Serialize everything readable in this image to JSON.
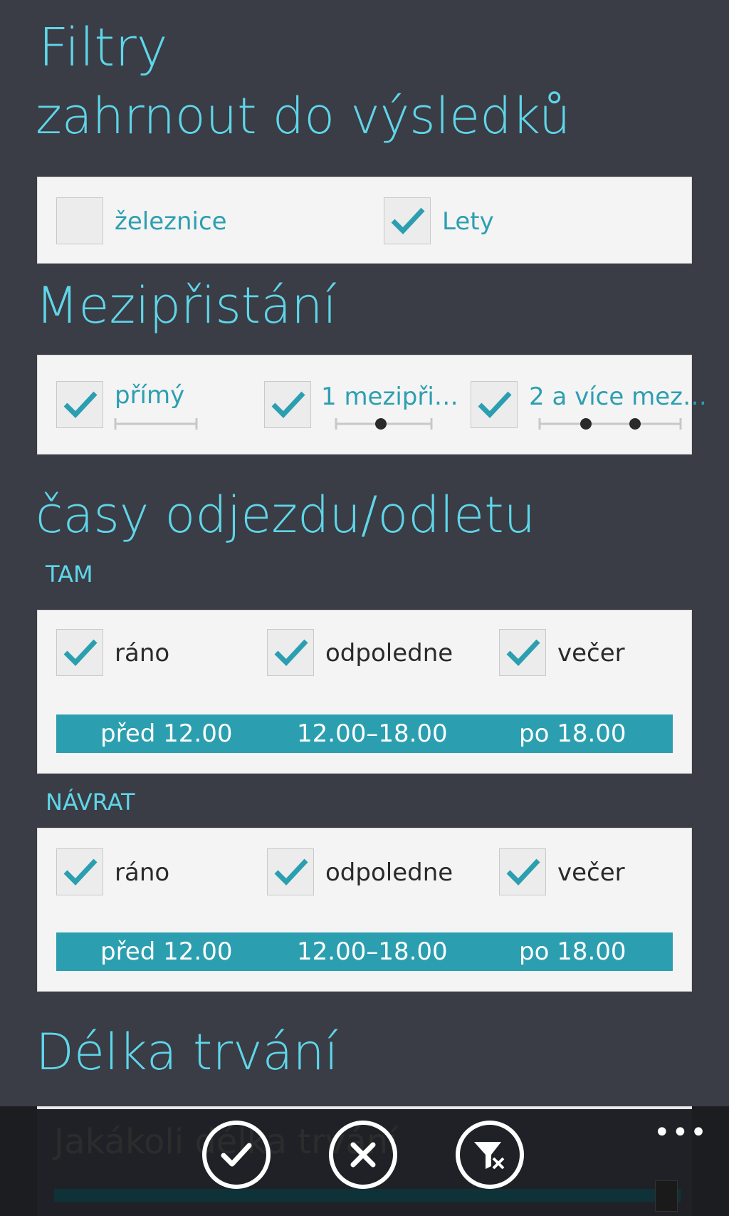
{
  "page_title": "Filtry",
  "include": {
    "heading": "zahrnout do výsledků",
    "options": [
      {
        "label": "železnice",
        "checked": false
      },
      {
        "label": "Lety",
        "checked": true
      }
    ]
  },
  "stops": {
    "heading": "Mezipřistání",
    "options": [
      {
        "label": "přímý",
        "checked": true,
        "stop_count": 0
      },
      {
        "label": "1 mezipři…",
        "checked": true,
        "stop_count": 1
      },
      {
        "label": "2 a více mez…",
        "checked": true,
        "stop_count": 2
      }
    ]
  },
  "times": {
    "heading": "časy odjezdu/odletu",
    "outbound": {
      "label": "TAM",
      "options": [
        {
          "label": "ráno",
          "checked": true
        },
        {
          "label": "odpoledne",
          "checked": true
        },
        {
          "label": "večer",
          "checked": true
        }
      ],
      "ranges": [
        "před 12.00",
        "12.00–18.00",
        "po 18.00"
      ]
    },
    "return": {
      "label": "NÁVRAT",
      "options": [
        {
          "label": "ráno",
          "checked": true
        },
        {
          "label": "odpoledne",
          "checked": true
        },
        {
          "label": "večer",
          "checked": true
        }
      ],
      "ranges": [
        "před 12.00",
        "12.00–18.00",
        "po 18.00"
      ]
    }
  },
  "duration": {
    "heading": "Délka trvání",
    "value_text": "Jakákoli délka trvání"
  },
  "app_bar": {
    "buttons": [
      {
        "name": "confirm",
        "icon": "checkmark-icon"
      },
      {
        "name": "cancel",
        "icon": "close-icon"
      },
      {
        "name": "clear-filter",
        "icon": "clear-filter-icon"
      }
    ],
    "more": "•••"
  },
  "colors": {
    "accent": "#5ed6e8",
    "teal": "#2b9fb0",
    "background": "#3a3c46",
    "card": "#f4f4f4"
  }
}
